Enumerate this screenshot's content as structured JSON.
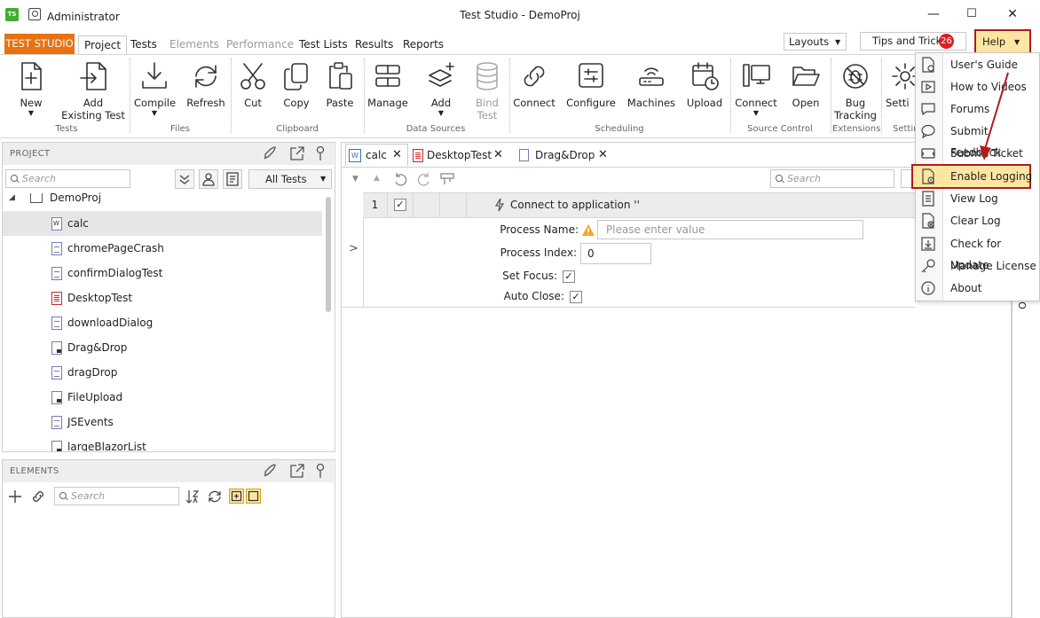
{
  "window": {
    "user": "Administrator",
    "title": "Test Studio - DemoProj",
    "minimize": "—",
    "maximize": "☐",
    "close": "✕"
  },
  "ribbon_tabs": {
    "brand": "TEST STUDIO",
    "tabs": [
      "Project",
      "Tests",
      "Elements",
      "Performance",
      "Test Lists",
      "Results",
      "Reports"
    ]
  },
  "top_right": {
    "layouts": "Layouts",
    "tips": "Tips and Tricks",
    "tips_count": "26",
    "help": "Help"
  },
  "ribbon": {
    "new": "New",
    "add_existing": "Add\nExisting Test",
    "compile": "Compile",
    "refresh": "Refresh",
    "cut": "Cut",
    "copy": "Copy",
    "paste": "Paste",
    "manage": "Manage",
    "add": "Add",
    "bind_test": "Bind\nTest",
    "connect": "Connect",
    "configure": "Configure",
    "machines": "Machines",
    "upload": "Upload",
    "connect_sc": "Connect",
    "open": "Open",
    "bug_tracking": "Bug\nTracking",
    "settings": "Setti",
    "groups": {
      "tests": "Tests",
      "files": "Files",
      "clipboard": "Clipboard",
      "data_sources": "Data Sources",
      "scheduling": "Scheduling",
      "source_control": "Source Control",
      "extensions": "Extensions",
      "settings": "Settin"
    }
  },
  "project_panel": {
    "header": "PROJECT",
    "search_placeholder": "Search",
    "filter": "All Tests",
    "root": "DemoProj",
    "items": [
      "calc",
      "chromePageCrash",
      "confirmDialogTest",
      "DesktopTest",
      "downloadDialog",
      "Drag&Drop",
      "dragDrop",
      "FileUpload",
      "JSEvents",
      "largeBlazorList"
    ]
  },
  "elements_panel": {
    "header": "ELEMENTS",
    "search_placeholder": "Search"
  },
  "editor": {
    "tabs": [
      "calc",
      "DesktopTest",
      "Drag&Drop"
    ],
    "search_placeholder": "Search",
    "step_number": "1",
    "step_title": "Connect to application ''",
    "expand": ">",
    "process_name_label": "Process Name:",
    "process_name_placeholder": "Please enter value",
    "process_index_label": "Process Index:",
    "process_index_value": "0",
    "set_focus_label": "Set Focus:",
    "auto_close_label": "Auto Close:",
    "side_label": "O"
  },
  "help_menu": {
    "items": [
      "User's Guide",
      "How to Videos",
      "Forums",
      "Submit Feedback",
      "Submit Ticket",
      "Enable Logging",
      "View Log",
      "Clear Log",
      "Check for Update",
      "Manage License",
      "About"
    ]
  },
  "colors": {
    "brand": "#e87212",
    "highlight_border": "#b01b1e",
    "highlight_fill": "#fde6a1",
    "badge": "#d81f26"
  }
}
